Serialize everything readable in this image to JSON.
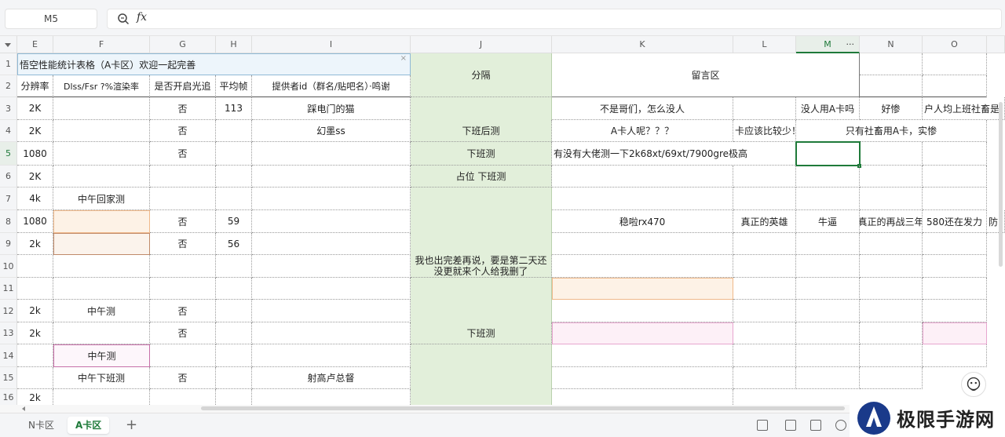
{
  "formula_bar": {
    "cell_ref": "M5",
    "fx_label": "fx",
    "formula": ""
  },
  "columns": [
    {
      "id": "A",
      "label": ""
    },
    {
      "id": "E",
      "label": "E"
    },
    {
      "id": "F",
      "label": "F"
    },
    {
      "id": "G",
      "label": "G"
    },
    {
      "id": "H",
      "label": "H"
    },
    {
      "id": "I",
      "label": "I"
    },
    {
      "id": "J",
      "label": "J"
    },
    {
      "id": "K",
      "label": "K"
    },
    {
      "id": "L",
      "label": "L"
    },
    {
      "id": "M",
      "label": "M"
    },
    {
      "id": "N",
      "label": "N"
    },
    {
      "id": "O",
      "label": "O"
    }
  ],
  "column_menu_icon": "···",
  "rows": [
    "1",
    "2",
    "3",
    "4",
    "5",
    "6",
    "7",
    "8",
    "9",
    "10",
    "11",
    "12",
    "13",
    "14",
    "15",
    "16"
  ],
  "selected": {
    "column": "M",
    "row": "5"
  },
  "cells": {
    "title": "悟空性能统计表格（A卡区）欢迎一起完善",
    "j_header": "分隔",
    "k_header": "留言区",
    "h2_e": "分辨率",
    "h2_f": "Dlss/Fsr ?%渲染率",
    "h2_g": "是否开启光追",
    "h2_h": "平均帧",
    "h2_i": "提供者id（群名/贴吧名）·鸣谢",
    "r3": {
      "e": "2K",
      "g": "否",
      "h": "113",
      "i": "踩电门的猫",
      "k": "不是哥们，怎么没人",
      "m": "没人用A卡吗",
      "n": "好惨",
      "o": "户人均上班社畜是"
    },
    "r4": {
      "e": "2K",
      "g": "否",
      "i": "幻墨ss",
      "j": "下班后测",
      "k": "A卡人呢？？？",
      "l": "卡应该比较少！",
      "mn": "只有社畜用A卡，实惨"
    },
    "r5": {
      "e": "1080",
      "g": "否",
      "j": "下班测",
      "k": "有没有大佬测一下2k68xt/69xt/7900gre极高"
    },
    "r6": {
      "e": "2K",
      "j": "占位 下班测"
    },
    "r7": {
      "e": "4k",
      "f": "中午回家测"
    },
    "r8": {
      "e": "1080",
      "g": "否",
      "h": "59",
      "k": "稳啦rx470",
      "l": "真正的英雄",
      "m": "牛逼",
      "n": "真正的再战三年",
      "o": "580还在发力",
      "p": "防"
    },
    "r9": {
      "e": "2k",
      "g": "否",
      "h": "56"
    },
    "r10": {
      "j": "我也出完差再说，要是第二天还没更就来个人给我删了"
    },
    "r12": {
      "e": "2k",
      "f": "中午测",
      "g": "否"
    },
    "r13": {
      "e": "2k",
      "g": "否",
      "j": "下班测"
    },
    "r14": {
      "f": "中午测"
    },
    "r15": {
      "f": "中午下班测",
      "g": "否",
      "i": "射高卢总督"
    },
    "r16": {
      "e": "2k"
    }
  },
  "tabs": [
    {
      "label": "N卡区",
      "active": false
    },
    {
      "label": "A卡区",
      "active": true
    }
  ],
  "add_tab": "+",
  "watermark": {
    "text": "极限手游网"
  },
  "colors": {
    "accent": "#1f7a3a",
    "separator_column": "#e2efda"
  }
}
